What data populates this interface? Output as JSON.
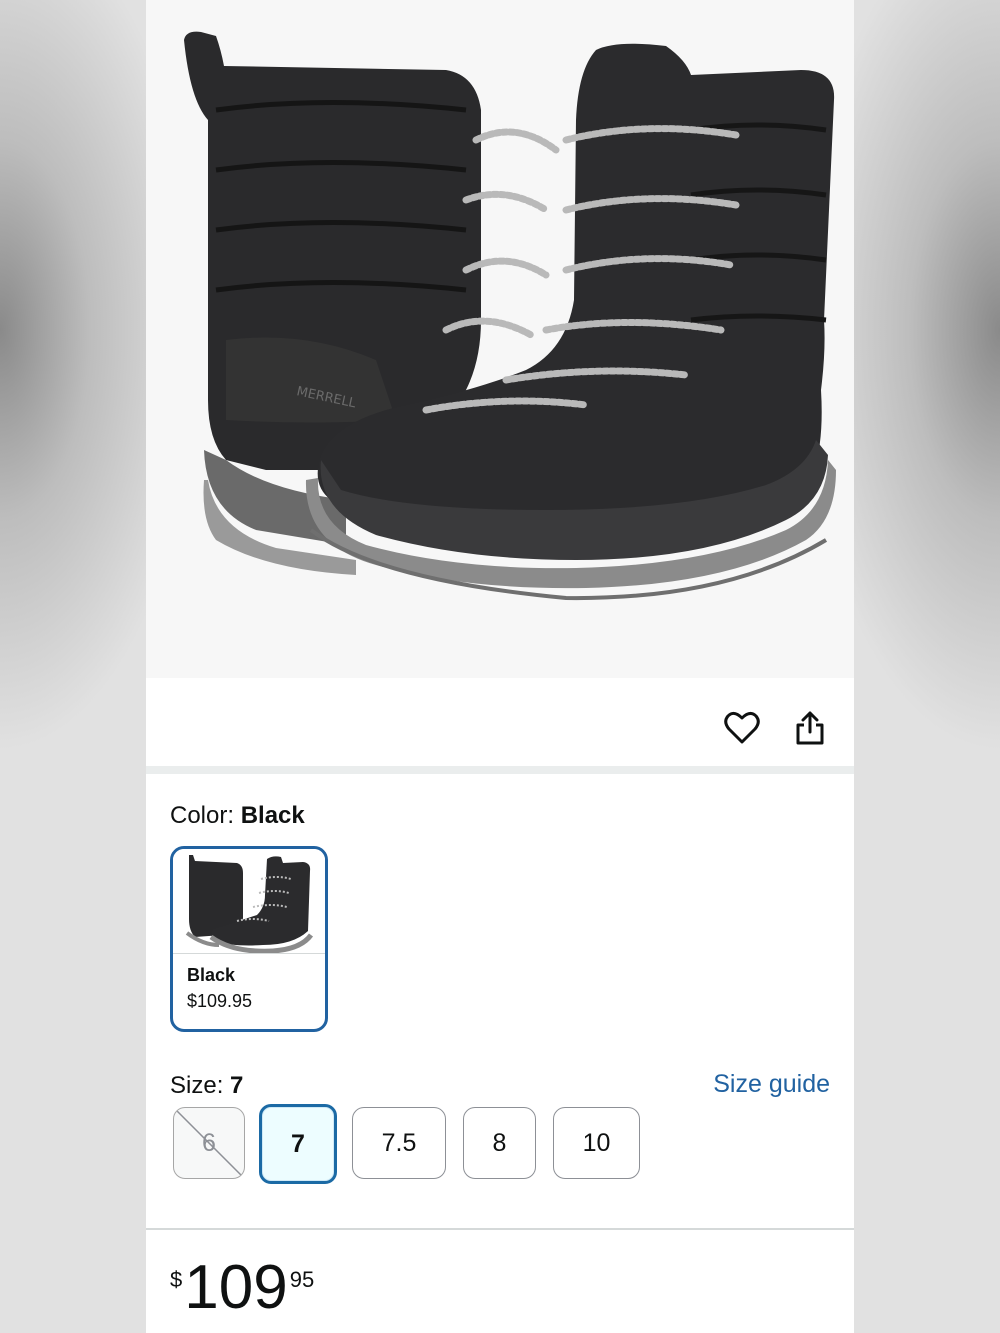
{
  "product": {
    "image_alt": "boots",
    "brand_mark": "MERRELL"
  },
  "actions": {
    "wishlist_icon": "heart-icon",
    "share_icon": "share-icon"
  },
  "color": {
    "prefix": "Color:",
    "value": "Black",
    "swatches": [
      {
        "name": "Black",
        "price": "$109.95",
        "selected": true
      }
    ]
  },
  "size": {
    "prefix": "Size:",
    "value": "7",
    "guide_label": "Size guide",
    "options": [
      {
        "label": "6",
        "available": false,
        "selected": false
      },
      {
        "label": "7",
        "available": true,
        "selected": true
      },
      {
        "label": "7.5",
        "available": true,
        "selected": false
      },
      {
        "label": "8",
        "available": true,
        "selected": false
      },
      {
        "label": "10",
        "available": true,
        "selected": false
      }
    ]
  },
  "price": {
    "symbol": "$",
    "whole": "109",
    "fraction": "95"
  },
  "colors": {
    "link": "#2162a1",
    "selected_border": "#1b6aa5",
    "selected_fill": "#edfdff"
  }
}
